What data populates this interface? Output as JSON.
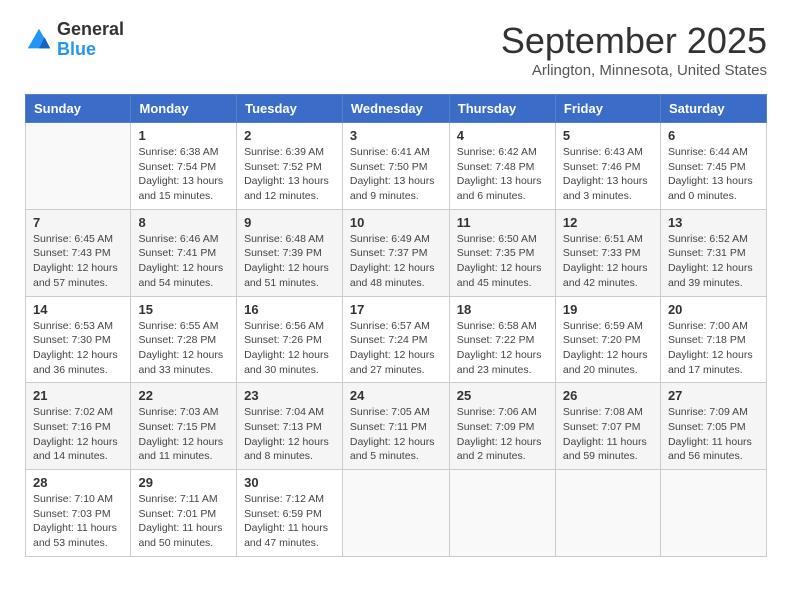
{
  "header": {
    "logo_general": "General",
    "logo_blue": "Blue",
    "month_title": "September 2025",
    "location": "Arlington, Minnesota, United States"
  },
  "days_of_week": [
    "Sunday",
    "Monday",
    "Tuesday",
    "Wednesday",
    "Thursday",
    "Friday",
    "Saturday"
  ],
  "weeks": [
    [
      {
        "day": "",
        "info": ""
      },
      {
        "day": "1",
        "info": "Sunrise: 6:38 AM\nSunset: 7:54 PM\nDaylight: 13 hours\nand 15 minutes."
      },
      {
        "day": "2",
        "info": "Sunrise: 6:39 AM\nSunset: 7:52 PM\nDaylight: 13 hours\nand 12 minutes."
      },
      {
        "day": "3",
        "info": "Sunrise: 6:41 AM\nSunset: 7:50 PM\nDaylight: 13 hours\nand 9 minutes."
      },
      {
        "day": "4",
        "info": "Sunrise: 6:42 AM\nSunset: 7:48 PM\nDaylight: 13 hours\nand 6 minutes."
      },
      {
        "day": "5",
        "info": "Sunrise: 6:43 AM\nSunset: 7:46 PM\nDaylight: 13 hours\nand 3 minutes."
      },
      {
        "day": "6",
        "info": "Sunrise: 6:44 AM\nSunset: 7:45 PM\nDaylight: 13 hours\nand 0 minutes."
      }
    ],
    [
      {
        "day": "7",
        "info": "Sunrise: 6:45 AM\nSunset: 7:43 PM\nDaylight: 12 hours\nand 57 minutes."
      },
      {
        "day": "8",
        "info": "Sunrise: 6:46 AM\nSunset: 7:41 PM\nDaylight: 12 hours\nand 54 minutes."
      },
      {
        "day": "9",
        "info": "Sunrise: 6:48 AM\nSunset: 7:39 PM\nDaylight: 12 hours\nand 51 minutes."
      },
      {
        "day": "10",
        "info": "Sunrise: 6:49 AM\nSunset: 7:37 PM\nDaylight: 12 hours\nand 48 minutes."
      },
      {
        "day": "11",
        "info": "Sunrise: 6:50 AM\nSunset: 7:35 PM\nDaylight: 12 hours\nand 45 minutes."
      },
      {
        "day": "12",
        "info": "Sunrise: 6:51 AM\nSunset: 7:33 PM\nDaylight: 12 hours\nand 42 minutes."
      },
      {
        "day": "13",
        "info": "Sunrise: 6:52 AM\nSunset: 7:31 PM\nDaylight: 12 hours\nand 39 minutes."
      }
    ],
    [
      {
        "day": "14",
        "info": "Sunrise: 6:53 AM\nSunset: 7:30 PM\nDaylight: 12 hours\nand 36 minutes."
      },
      {
        "day": "15",
        "info": "Sunrise: 6:55 AM\nSunset: 7:28 PM\nDaylight: 12 hours\nand 33 minutes."
      },
      {
        "day": "16",
        "info": "Sunrise: 6:56 AM\nSunset: 7:26 PM\nDaylight: 12 hours\nand 30 minutes."
      },
      {
        "day": "17",
        "info": "Sunrise: 6:57 AM\nSunset: 7:24 PM\nDaylight: 12 hours\nand 27 minutes."
      },
      {
        "day": "18",
        "info": "Sunrise: 6:58 AM\nSunset: 7:22 PM\nDaylight: 12 hours\nand 23 minutes."
      },
      {
        "day": "19",
        "info": "Sunrise: 6:59 AM\nSunset: 7:20 PM\nDaylight: 12 hours\nand 20 minutes."
      },
      {
        "day": "20",
        "info": "Sunrise: 7:00 AM\nSunset: 7:18 PM\nDaylight: 12 hours\nand 17 minutes."
      }
    ],
    [
      {
        "day": "21",
        "info": "Sunrise: 7:02 AM\nSunset: 7:16 PM\nDaylight: 12 hours\nand 14 minutes."
      },
      {
        "day": "22",
        "info": "Sunrise: 7:03 AM\nSunset: 7:15 PM\nDaylight: 12 hours\nand 11 minutes."
      },
      {
        "day": "23",
        "info": "Sunrise: 7:04 AM\nSunset: 7:13 PM\nDaylight: 12 hours\nand 8 minutes."
      },
      {
        "day": "24",
        "info": "Sunrise: 7:05 AM\nSunset: 7:11 PM\nDaylight: 12 hours\nand 5 minutes."
      },
      {
        "day": "25",
        "info": "Sunrise: 7:06 AM\nSunset: 7:09 PM\nDaylight: 12 hours\nand 2 minutes."
      },
      {
        "day": "26",
        "info": "Sunrise: 7:08 AM\nSunset: 7:07 PM\nDaylight: 11 hours\nand 59 minutes."
      },
      {
        "day": "27",
        "info": "Sunrise: 7:09 AM\nSunset: 7:05 PM\nDaylight: 11 hours\nand 56 minutes."
      }
    ],
    [
      {
        "day": "28",
        "info": "Sunrise: 7:10 AM\nSunset: 7:03 PM\nDaylight: 11 hours\nand 53 minutes."
      },
      {
        "day": "29",
        "info": "Sunrise: 7:11 AM\nSunset: 7:01 PM\nDaylight: 11 hours\nand 50 minutes."
      },
      {
        "day": "30",
        "info": "Sunrise: 7:12 AM\nSunset: 6:59 PM\nDaylight: 11 hours\nand 47 minutes."
      },
      {
        "day": "",
        "info": ""
      },
      {
        "day": "",
        "info": ""
      },
      {
        "day": "",
        "info": ""
      },
      {
        "day": "",
        "info": ""
      }
    ]
  ]
}
